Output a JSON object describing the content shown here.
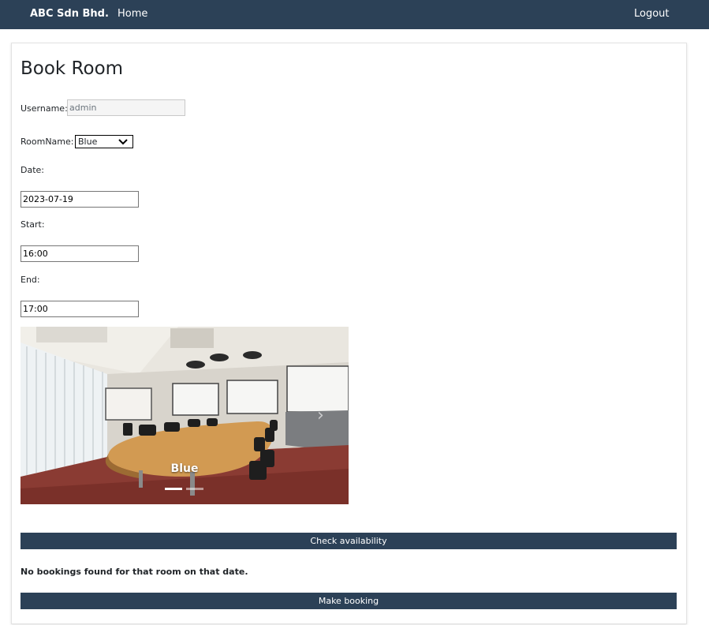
{
  "navbar": {
    "brand": "ABC Sdn Bhd.",
    "home": "Home",
    "logout": "Logout"
  },
  "page": {
    "title": "Book Room"
  },
  "form": {
    "username_label": "Username:",
    "username_value": "admin",
    "roomname_label": "RoomName:",
    "roomname_value": "Blue",
    "date_label": "Date:",
    "date_value": "2023-07-19",
    "start_label": "Start:",
    "start_value": "16:00",
    "end_label": "End:",
    "end_value": "17:00"
  },
  "carousel": {
    "caption": "Blue",
    "slide_count": 2,
    "active_slide": 1
  },
  "buttons": {
    "check": "Check availability",
    "book": "Make booking"
  },
  "message": "No bookings found for that room on that date.",
  "colors": {
    "navbar": "#2c4157",
    "button": "#2c4157"
  }
}
